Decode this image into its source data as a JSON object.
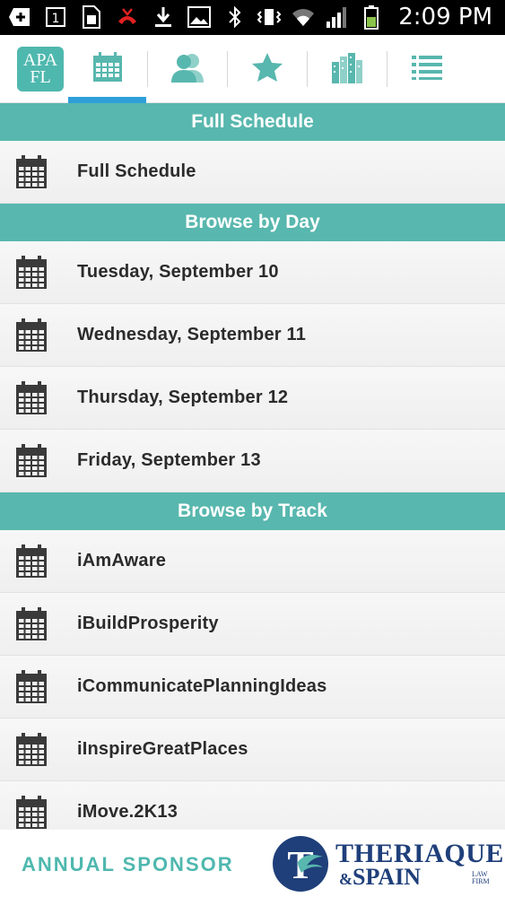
{
  "status_bar": {
    "time": "2:09 PM",
    "icons": [
      "add-icon",
      "calendar-one-icon",
      "sim-icon",
      "missed-call-icon",
      "download-icon",
      "image-icon",
      "bluetooth-icon",
      "vibrate-icon",
      "wifi-icon",
      "signal-icon",
      "battery-icon"
    ]
  },
  "tabbar": {
    "logo_line1": "APA",
    "logo_line2": "FL",
    "tabs": [
      {
        "icon": "calendar-icon",
        "active": true
      },
      {
        "icon": "people-icon",
        "active": false
      },
      {
        "icon": "star-icon",
        "active": false
      },
      {
        "icon": "buildings-icon",
        "active": false
      },
      {
        "icon": "list-icon",
        "active": false
      }
    ],
    "accent_color": "#2f9fd8",
    "brand_color": "#58b7ae"
  },
  "sections": [
    {
      "title": "Full Schedule",
      "items": [
        "Full Schedule"
      ]
    },
    {
      "title": "Browse by Day",
      "items": [
        "Tuesday, September 10",
        "Wednesday, September 11",
        "Thursday, September 12",
        "Friday, September 13"
      ]
    },
    {
      "title": "Browse by Track",
      "items": [
        "iAmAware",
        "iBuildProsperity",
        "iCommunicatePlanningIdeas",
        "iInspireGreatPlaces",
        "iMove.2K13"
      ]
    }
  ],
  "footer": {
    "sponsor_label": "ANNUAL SPONSOR",
    "firm_line1": "THERIAQUE",
    "firm_amp": "&",
    "firm_line2": "SPAIN",
    "firm_sub1": "LAW",
    "firm_sub2": "FIRM",
    "monogram": "T"
  }
}
